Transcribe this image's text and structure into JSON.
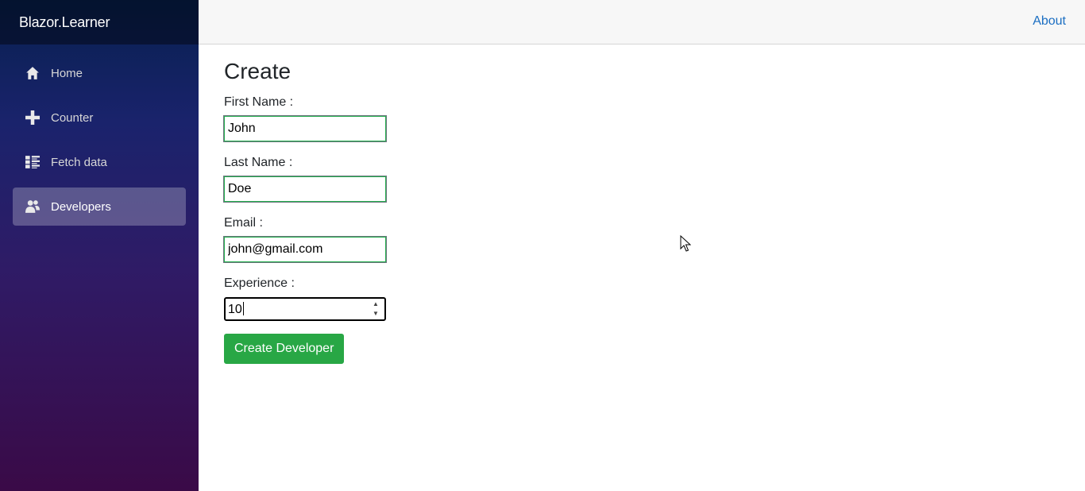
{
  "app": {
    "brand": "Blazor.Learner"
  },
  "sidebar": {
    "items": [
      {
        "label": "Home",
        "icon": "home-icon",
        "active": false
      },
      {
        "label": "Counter",
        "icon": "plus-icon",
        "active": false
      },
      {
        "label": "Fetch data",
        "icon": "list-icon",
        "active": false
      },
      {
        "label": "Developers",
        "icon": "people-icon",
        "active": true
      }
    ]
  },
  "topbar": {
    "about_label": "About"
  },
  "form": {
    "title": "Create",
    "first_name": {
      "label": "First Name :",
      "value": "John"
    },
    "last_name": {
      "label": "Last Name :",
      "value": "Doe"
    },
    "email": {
      "label": "Email :",
      "value": "john@gmail.com"
    },
    "experience": {
      "label": "Experience :",
      "value": "10"
    },
    "submit_label": "Create Developer"
  },
  "colors": {
    "link": "#1b6ec2",
    "success": "#28a745",
    "valid_border": "#26b050"
  }
}
